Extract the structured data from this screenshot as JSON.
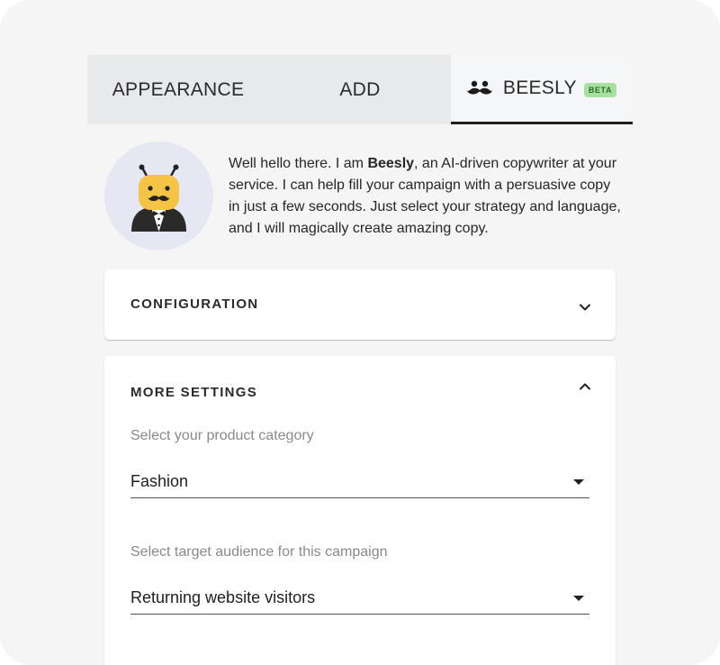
{
  "tabs": [
    {
      "label": "APPEARANCE"
    },
    {
      "label": "ADD"
    },
    {
      "label": "BEESLY",
      "badge": "BETA",
      "active": true
    }
  ],
  "intro": {
    "before": "Well hello there. I am ",
    "name": "Beesly",
    "after": ", an AI-driven copywriter at your service. I can help fill your campaign with a persuasive copy in just a few seconds. Just select your strategy and language, and I will magically create amazing copy."
  },
  "configuration": {
    "title": "CONFIGURATION",
    "expanded": false
  },
  "more_settings": {
    "title": "MORE SETTINGS",
    "expanded": true,
    "category_label": "Select your product category",
    "category_value": "Fashion",
    "audience_label": "Select target audience for this campaign",
    "audience_value": "Returning website visitors"
  },
  "colors": {
    "background": "#f5f5f5",
    "tab_inactive": "#e8e9eb",
    "beta_badge": "#a8e0a2",
    "avatar_circle": "#e5e8f3",
    "bee_yellow": "#f5c445"
  },
  "icons": {
    "beesly_tab": "mustache-icon",
    "configuration_toggle": "chevron-down-icon",
    "more_settings_toggle": "chevron-up-icon"
  }
}
